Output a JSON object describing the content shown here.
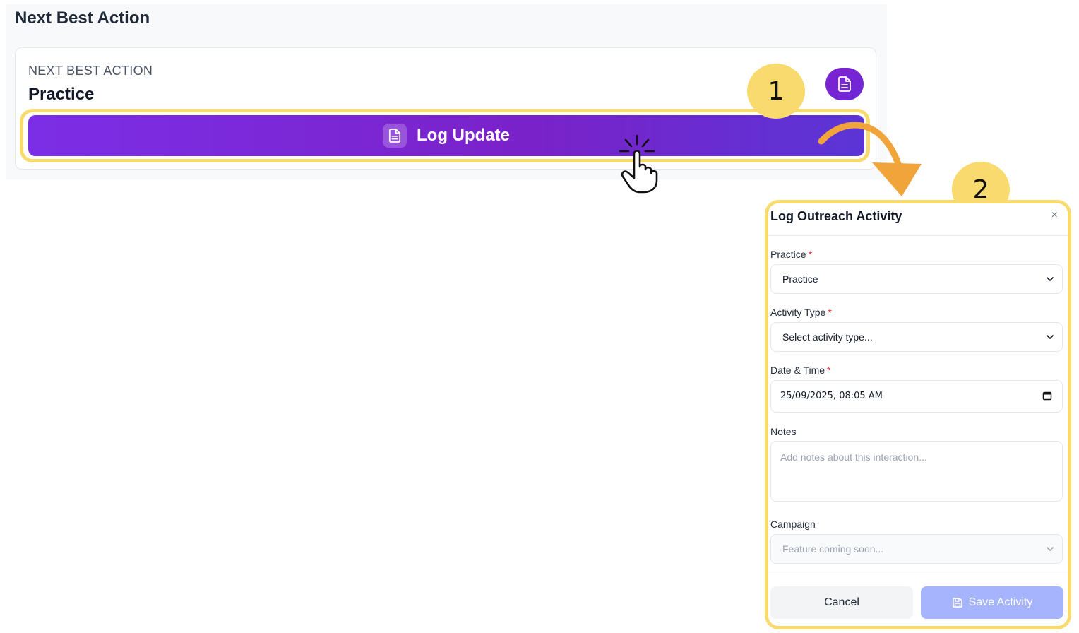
{
  "section": {
    "title": "Next Best Action"
  },
  "nba_card": {
    "eyebrow": "NEXT BEST ACTION",
    "practice": "Practice",
    "log_button_label": "Log Update"
  },
  "annotations": {
    "step1": "1",
    "step2": "2"
  },
  "modal": {
    "title": "Log Outreach Activity",
    "close": "×",
    "fields": {
      "practice": {
        "label": "Practice",
        "required": "*",
        "value": "Practice"
      },
      "activity_type": {
        "label": "Activity Type",
        "required": "*",
        "value": "Select activity type..."
      },
      "date_time": {
        "label": "Date & Time",
        "required": "*",
        "value": "25/09/2025, 08:05 AM"
      },
      "notes": {
        "label": "Notes",
        "placeholder": "Add notes about this interaction..."
      },
      "campaign": {
        "label": "Campaign",
        "value": "Feature coming soon..."
      }
    },
    "buttons": {
      "cancel": "Cancel",
      "save": "Save Activity"
    }
  },
  "colors": {
    "accent_purple": "#7c2ee6",
    "highlight_yellow": "#f9da6f",
    "save_disabled": "#a5b4fc",
    "required_red": "#dc2626"
  },
  "icons": [
    "document-icon",
    "chevron-down-icon",
    "calendar-icon",
    "close-icon",
    "save-icon",
    "pointer-hand-icon",
    "curved-arrow-icon"
  ]
}
